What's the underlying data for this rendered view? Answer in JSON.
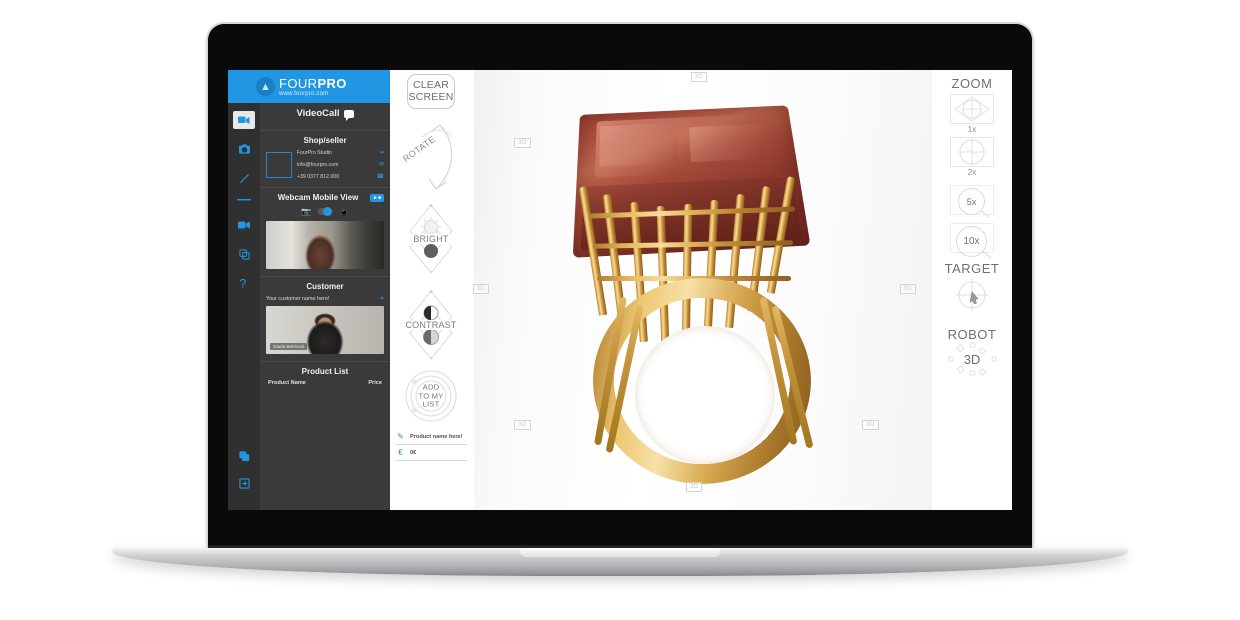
{
  "brand": {
    "name_light": "FOUR",
    "name_bold": "PRO",
    "url": "www.fourpro.com",
    "logo_icon": "fourpro-bird-logo",
    "color": "#2196e3"
  },
  "icon_rail": {
    "items": [
      {
        "name": "settings",
        "icon": "gear-icon",
        "active": false
      },
      {
        "name": "videocall",
        "icon": "video-chat-icon",
        "active": true
      },
      {
        "name": "camera",
        "icon": "camera-icon",
        "active": false
      },
      {
        "name": "draw",
        "icon": "pencil-icon",
        "active": false
      },
      {
        "name": "divider",
        "icon": "menu-divider",
        "active": false
      },
      {
        "name": "record",
        "icon": "camcorder-icon",
        "active": false
      },
      {
        "name": "duplicate",
        "icon": "copy-icon",
        "active": false
      },
      {
        "name": "help",
        "icon": "question-mark-icon",
        "active": false
      }
    ],
    "bottom_items": [
      {
        "name": "windows",
        "icon": "windows-copy-icon"
      },
      {
        "name": "logout",
        "icon": "logout-icon"
      }
    ]
  },
  "sidebar": {
    "videocall_title": "VideoCall",
    "videocall_icon": "chat-bubble-icon",
    "shop": {
      "title": "Shop/seller",
      "name": "FourPro Studio",
      "email": "info@fourpro.com",
      "phone": "+39 0377 812.000",
      "action_icons": [
        "share-icon",
        "mail-icon",
        "phone-icon"
      ]
    },
    "webcam": {
      "title": "Webcam Mobile View",
      "badge_icon": "camcorder-icon",
      "source_left_icon": "webcam-icon",
      "source_right_icon": "mobile-phone-icon",
      "toggle_state": "mobile"
    },
    "customer": {
      "title": "Customer",
      "placeholder_name": "Your customer name here!",
      "action_icon": "share-icon",
      "video_name_tag": "Giada Betticorti"
    },
    "product_list": {
      "title": "Product List",
      "col_product": "Product Name",
      "col_price": "Price"
    }
  },
  "viewer": {
    "clear_screen_line1": "CLEAR",
    "clear_screen_line2": "SCREEN",
    "rotate_label": "ROTATE",
    "bright": {
      "label": "BRIGHT",
      "plus": "+",
      "minus": "-",
      "icon": "sun-icon"
    },
    "contrast": {
      "label": "CONTRAST",
      "plus": "+",
      "minus": "-",
      "icon": "half-circle-icon"
    },
    "add_to_list": {
      "line1": "ADD",
      "line2": "TO MY",
      "line3": "LIST"
    },
    "product_name_field": {
      "icon": "pencil-icon",
      "value": "Product name here!"
    },
    "price_field": {
      "icon": "euro-icon",
      "value": "0€"
    },
    "handles": [
      {
        "label": "3D",
        "pos": "top"
      },
      {
        "label": "3D",
        "pos": "top-left"
      },
      {
        "label": "3D",
        "pos": "left"
      },
      {
        "label": "3D",
        "pos": "right"
      },
      {
        "label": "3D",
        "pos": "bottom-left"
      },
      {
        "label": "3D",
        "pos": "bottom-right"
      },
      {
        "label": "3D",
        "pos": "bottom"
      }
    ],
    "product_image_alt": "gold ring with large rectangular pink tourmaline gemstone"
  },
  "right_panel": {
    "zoom_title": "ZOOM",
    "zoom_levels": [
      {
        "label": "1x",
        "icon": "crosshair-box-icon",
        "style": "box"
      },
      {
        "label": "2x",
        "icon": "crosshair-circle-icon",
        "style": "box"
      },
      {
        "label": "5x",
        "icon": "magnifier-icon",
        "style": "magnifier"
      },
      {
        "label": "10x",
        "icon": "magnifier-icon",
        "style": "magnifier"
      }
    ],
    "target_title": "TARGET",
    "target_icon": "crosshair-cursor-icon",
    "robot_title": "ROBOT",
    "robot_value": "3D",
    "robot_icon": "directional-arrows-icon"
  }
}
